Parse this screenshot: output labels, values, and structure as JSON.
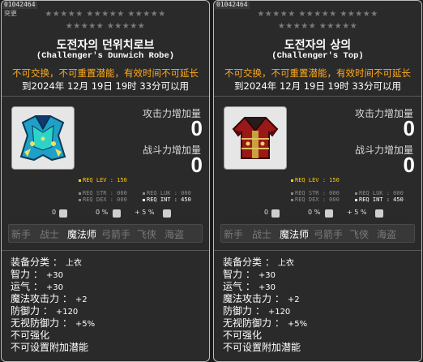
{
  "items": [
    {
      "id": "01042464",
      "flag": "突更",
      "stars_row1": "★★★★★ ★★★★★ ★★★★★",
      "stars_row2": "★★★★★ ★★★★★",
      "name_ko": "도전자의 던위치로브",
      "name_en": "(Challenger's Dunwich Robe)",
      "notice": "不可交换，不可重置潜能，有效时间不可延长",
      "expiry": "到2024年 12月 19日 19时 33分可以用",
      "icon": "dunwich-robe-icon",
      "attack_label": "攻击力增加量",
      "attack_value": "0",
      "combat_label": "战斗力增加量",
      "combat_value": "0",
      "requirements": {
        "lev": "REQ LEV : 150",
        "str": "REQ STR : 000",
        "luk": "REQ LUK : 000",
        "dex": "REQ DEX : 000",
        "int": "REQ INT : 450"
      },
      "percents": [
        "0",
        "0 %",
        "+ 5 %"
      ],
      "jobs": [
        "新手",
        "战士",
        "魔法师",
        "弓箭手",
        "飞侠",
        "海盗"
      ],
      "active_job": "魔法师",
      "specs": [
        {
          "label": "装备分类 ：",
          "value": "上衣"
        },
        {
          "label": "智力 ：",
          "value": "+30"
        },
        {
          "label": "运气 ：",
          "value": "+30"
        },
        {
          "label": "魔法攻击力 ：",
          "value": "+2"
        },
        {
          "label": "防御力 ：",
          "value": "+120"
        },
        {
          "label": "无视防御力 ：",
          "value": "+5%"
        },
        {
          "label": "不可强化",
          "value": ""
        },
        {
          "label": "不可设置附加潜能",
          "value": ""
        }
      ]
    },
    {
      "id": "01042464",
      "flag": "",
      "stars_row1": "★★★★★ ★★★★★ ★★★★★",
      "stars_row2": "★★★★★ ★★★★★",
      "name_ko": "도전자의 상의",
      "name_en": "(Challenger's Top)",
      "notice": "不可交换，不可重置潜能，有效时间不可延长",
      "expiry": "到2024年 12月 19日 19时 33分可以用",
      "icon": "challenger-top-icon",
      "attack_label": "攻击力增加量",
      "attack_value": "0",
      "combat_label": "战斗力增加量",
      "combat_value": "0",
      "requirements": {
        "lev": "REQ LEV : 150",
        "str": "REQ STR : 000",
        "luk": "REQ LUK : 000",
        "dex": "REQ DEX : 000",
        "int": "REQ INT : 450"
      },
      "percents": [
        "0",
        "0 %",
        "+ 5 %"
      ],
      "jobs": [
        "新手",
        "战士",
        "魔法师",
        "弓箭手",
        "飞侠",
        "海盗"
      ],
      "active_job": "魔法师",
      "specs": [
        {
          "label": "装备分类 ：",
          "value": "上衣"
        },
        {
          "label": "智力 ：",
          "value": "+30"
        },
        {
          "label": "运气 ：",
          "value": "+30"
        },
        {
          "label": "魔法攻击力 ：",
          "value": "+2"
        },
        {
          "label": "防御力 ：",
          "value": "+120"
        },
        {
          "label": "无视防御力 ：",
          "value": "+5%"
        },
        {
          "label": "不可强化",
          "value": ""
        },
        {
          "label": "不可设置附加潜能",
          "value": ""
        }
      ]
    }
  ],
  "colors": {
    "panel_bg": "#2a2a2a",
    "notice": "#ffab1f",
    "req_highlight": "#ffcc00",
    "text": "#ffffff",
    "muted": "#7a7a7a"
  }
}
